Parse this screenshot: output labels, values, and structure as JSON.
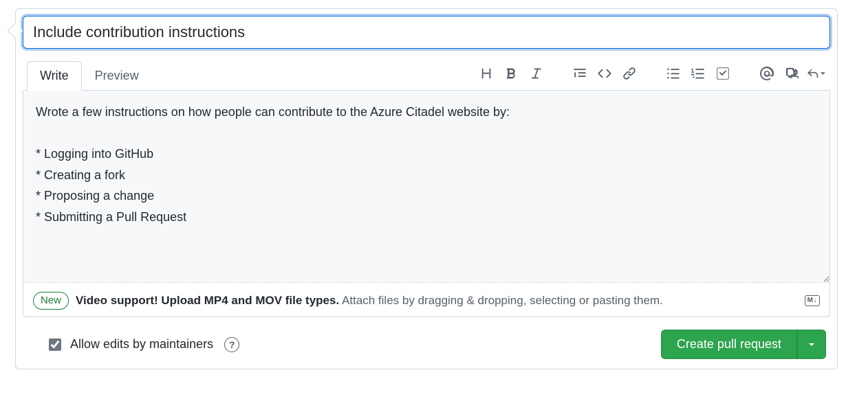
{
  "title_value": "Include contribution instructions",
  "tabs": {
    "write": "Write",
    "preview": "Preview",
    "active": "write"
  },
  "body_value": "Wrote a few instructions on how people can contribute to the Azure Citadel website by:\n\n* Logging into GitHub\n* Creating a fork\n* Proposing a change\n* Submitting a Pull Request",
  "attach": {
    "badge": "New",
    "bold": "Video support! Upload MP4 and MOV file types.",
    "rest": "Attach files by dragging & dropping, selecting or pasting them."
  },
  "markdown_badge": "M↓",
  "allow_edits": {
    "label": "Allow edits by maintainers",
    "checked": true
  },
  "submit": {
    "primary": "Create pull request"
  }
}
